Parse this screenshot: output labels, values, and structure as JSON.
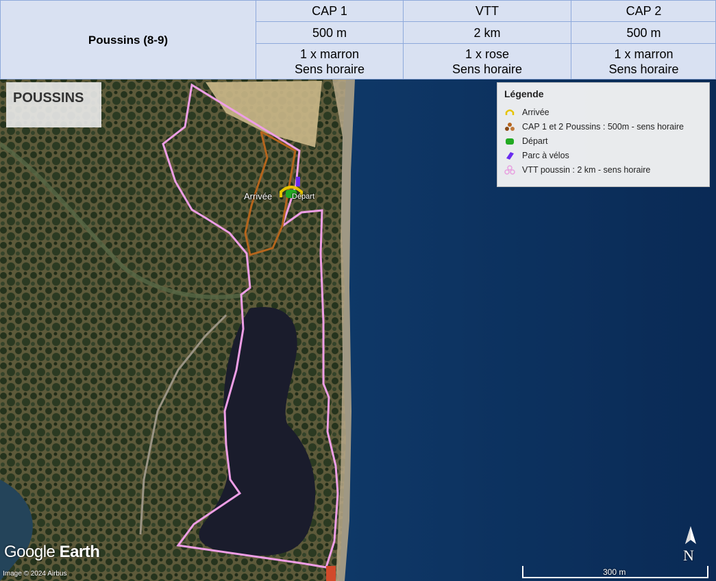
{
  "table": {
    "row_label": "Poussins (8-9)",
    "columns": [
      {
        "header": "CAP 1",
        "distance": "500 m",
        "loop": "1 x marron",
        "direction": "Sens horaire"
      },
      {
        "header": "VTT",
        "distance": "2 km",
        "loop": "1 x rose",
        "direction": "Sens horaire"
      },
      {
        "header": "CAP 2",
        "distance": "500 m",
        "loop": "1 x marron",
        "direction": "Sens horaire"
      }
    ]
  },
  "map": {
    "title": "POUSSINS",
    "labels": {
      "arrivee": "Arrivée",
      "depart": "Départ"
    },
    "legend": {
      "title": "Légende",
      "items": [
        {
          "label": "Arrivée",
          "icon": "arrival-icon",
          "color": "#e6c400"
        },
        {
          "label": "CAP 1 et 2 Poussins : 500m - sens horaire",
          "icon": "run-route-icon",
          "color": "#b5651d"
        },
        {
          "label": "Départ",
          "icon": "start-icon",
          "color": "#22aa22"
        },
        {
          "label": "Parc à vélos",
          "icon": "bike-park-icon",
          "color": "#6a2cf0"
        },
        {
          "label": "VTT poussin : 2 km - sens horaire",
          "icon": "bike-route-icon",
          "color": "#e8a0e0"
        }
      ]
    },
    "brand": "Google Earth",
    "brand_bold": "Earth",
    "brand_light": "Google ",
    "copyright": "Image © 2024 Airbus",
    "scale_label": "300 m",
    "north_label": "N"
  },
  "colors": {
    "table_bg": "#d9e1f2",
    "table_border": "#8ea9db",
    "sea": "#0d3560",
    "land": "#3c4a2a",
    "run_route": "#b5651d",
    "bike_route": "#ee9ee6"
  }
}
